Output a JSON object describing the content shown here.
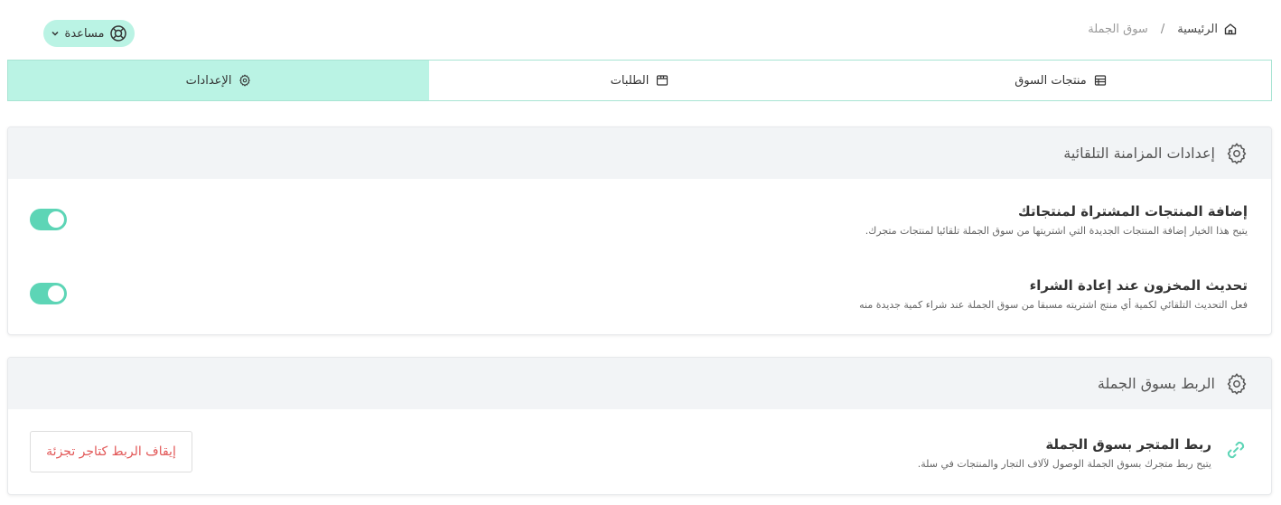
{
  "breadcrumb": {
    "home": "الرئيسية",
    "separator": "/",
    "current": "سوق الجملة"
  },
  "help": {
    "label": "مساعدة"
  },
  "tabs": [
    {
      "label": "منتجات السوق",
      "icon": "store-icon"
    },
    {
      "label": "الطلبات",
      "icon": "box-icon"
    },
    {
      "label": "الإعدادات",
      "icon": "gear-icon",
      "active": true
    }
  ],
  "auto_sync": {
    "title": "إعدادات المزامنة التلقائية",
    "settings": [
      {
        "title": "إضافة المنتجات المشتراة لمنتجاتك",
        "description": "يتيح هذا الخيار إضافة المنتجات الجديدة التي اشتريتها من سوق الجملة تلقائيا لمنتجات متجرك.",
        "enabled": true
      },
      {
        "title": "تحديث المخزون عند إعادة الشراء",
        "description": "فعل التحديث التلقائي لكمية أي منتج اشتريته مسبقا من سوق الجملة عند شراء كمية جديدة منه",
        "enabled": true
      }
    ]
  },
  "connection": {
    "title": "الربط بسوق الجملة",
    "row_title": "ربط المتجر بسوق الجملة",
    "row_description": "يتيح ربط متجرك بسوق الجملة الوصول لآلاف التجار والمنتجات في سلة.",
    "button_label": "إيقاف الربط كتاجر تجزئة"
  },
  "colors": {
    "accent": "#baf3e4",
    "toggle_on": "#5dd5b6",
    "danger": "#e25858"
  }
}
